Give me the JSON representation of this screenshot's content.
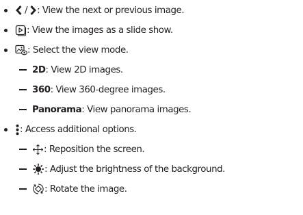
{
  "items": [
    {
      "icon": "chevron-left-right-icon",
      "separator": "/",
      "text": ": View the next or previous image."
    },
    {
      "icon": "slideshow-icon",
      "text": ": View the images as a slide show."
    },
    {
      "icon": "view-mode-icon",
      "text": " : Select the view mode."
    }
  ],
  "view_modes": [
    {
      "label": "2D",
      "text": ": View 2D images."
    },
    {
      "label": "360",
      "text": ": View 360-degree images."
    },
    {
      "label": "Panorama",
      "text": ": View panorama images."
    }
  ],
  "more": {
    "icon": "more-options-icon",
    "text": ": Access additional options."
  },
  "options": [
    {
      "icon": "move-arrows-icon",
      "text": " : Reposition the screen."
    },
    {
      "icon": "brightness-icon",
      "text": " : Adjust the brightness of the background."
    },
    {
      "icon": "rotate-icon",
      "text": " : Rotate the image."
    }
  ]
}
